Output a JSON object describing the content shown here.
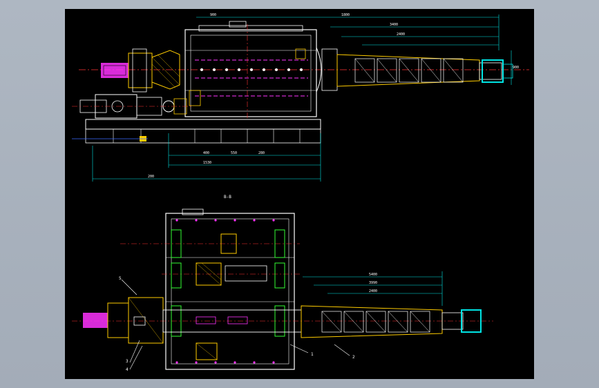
{
  "drawing": {
    "section_label": "B-B",
    "top_view_dimensions": [
      "1800",
      "3400",
      "2400",
      "900",
      "400",
      "550",
      "280",
      "1530",
      "200",
      "900"
    ],
    "bottom_view_dimensions": [
      "5400",
      "3990",
      "2400"
    ],
    "callouts": [
      "1",
      "2",
      "3",
      "4",
      "5"
    ]
  },
  "colors": {
    "background": "#a9b2bd",
    "sheet": "#000000",
    "outline": "#ffffff",
    "dimension": "#00e5e5",
    "hatch": "#ffcc00",
    "centerline": "#ff3333",
    "highlight": "#ff33ff",
    "structure": "#33ff33",
    "blue": "#3a6cff"
  }
}
